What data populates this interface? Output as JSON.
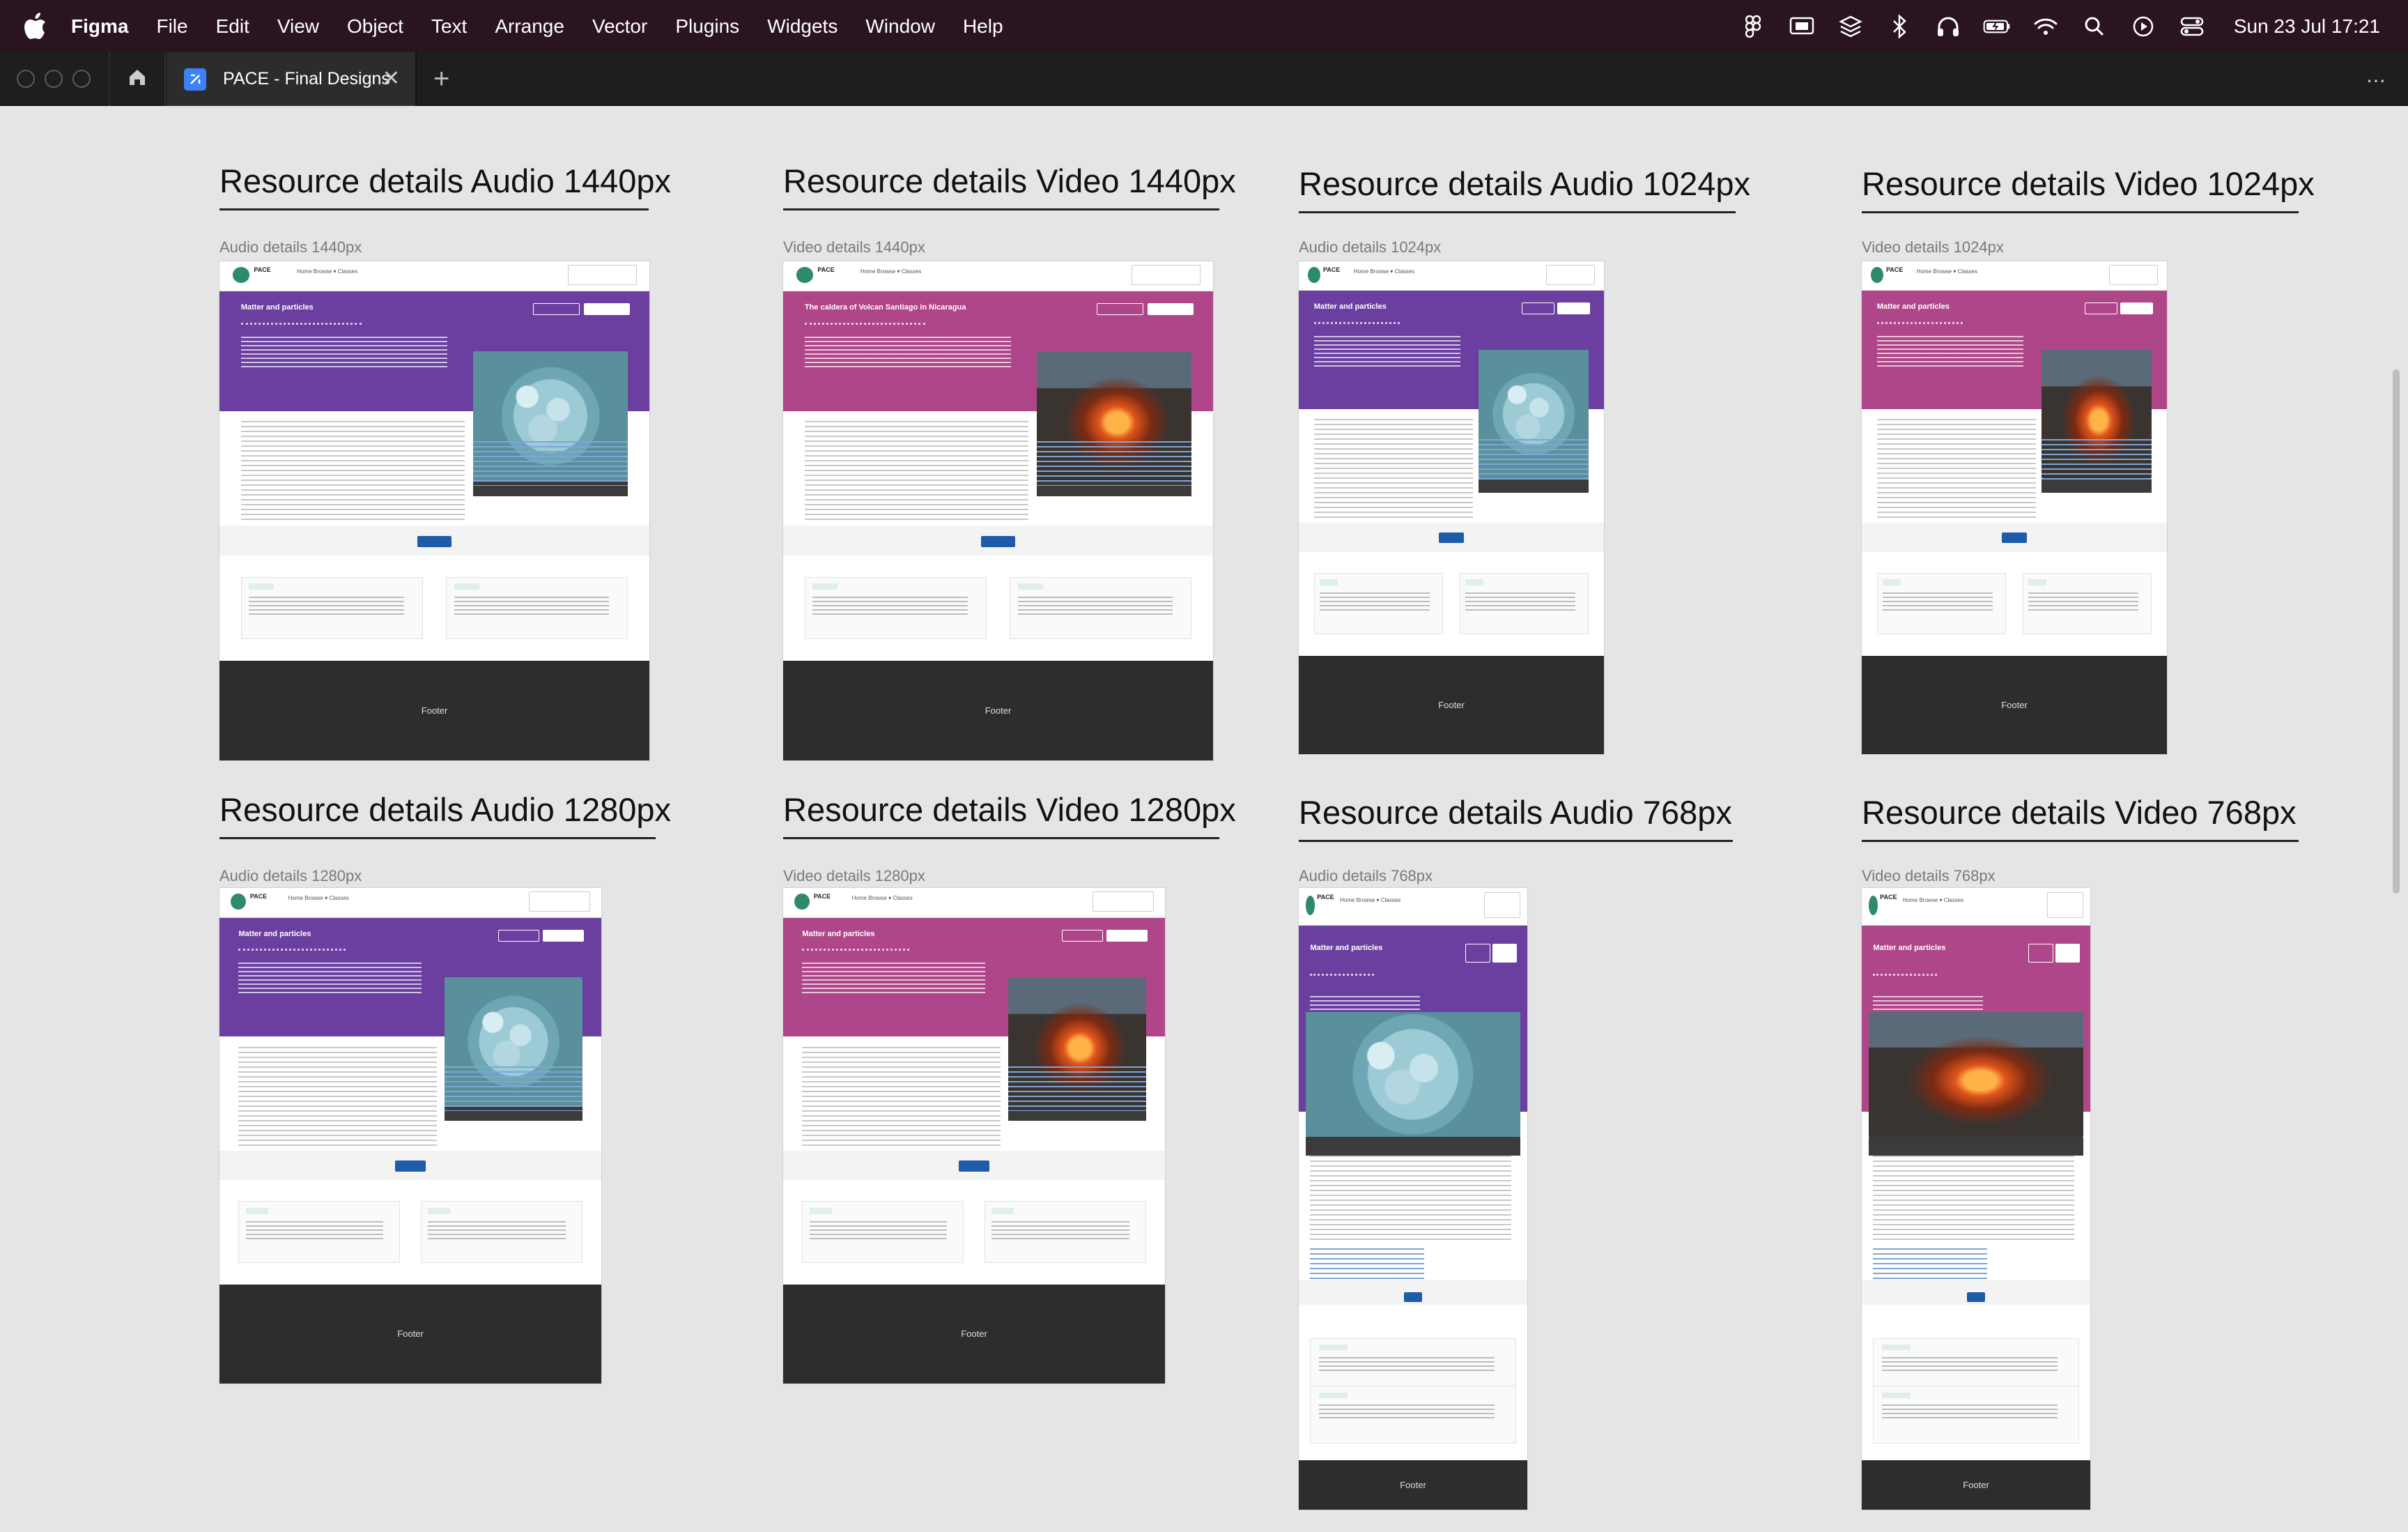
{
  "menubar": {
    "app_name": "Figma",
    "items": [
      "File",
      "Edit",
      "View",
      "Object",
      "Text",
      "Arrange",
      "Vector",
      "Plugins",
      "Widgets",
      "Window",
      "Help"
    ],
    "clock": "Sun 23 Jul  17:21",
    "status_icons": [
      "figma-icon",
      "screen-mirror-icon",
      "layers-icon",
      "bluetooth-icon",
      "headphones-icon",
      "battery-icon",
      "wifi-icon",
      "search-icon",
      "play-icon",
      "control-center-icon"
    ]
  },
  "tabbar": {
    "active_tab": "PACE - Final Designs",
    "new_tab": "+",
    "more": "⋯",
    "close": "✕"
  },
  "colors": {
    "audio_hero": "#6b3fa0",
    "video_hero": "#b0468a",
    "footer": "#2d2d2d",
    "menubar": "#2a1420",
    "link": "#1e5ba8"
  },
  "frame_content": {
    "nav_links": "Home  Browse ▾  Classes",
    "logo": "PACE",
    "audio_title": "Matter and particles",
    "video_title": "The caldera of Volcan Santiago in Nicaragua",
    "video_title_short": "Matter and particles",
    "footer": "Footer"
  },
  "sections": [
    {
      "title": "Resource details Audio 1440px",
      "label": "Audio details 1440px"
    },
    {
      "title": "Resource details Video 1440px",
      "label": "Video details 1440px"
    },
    {
      "title": "Resource details Audio 1024px",
      "label": "Audio details 1024px"
    },
    {
      "title": "Resource details Video 1024px",
      "label": "Video details 1024px"
    },
    {
      "title": "Resource details Audio 1280px",
      "label": "Audio details 1280px"
    },
    {
      "title": "Resource details Video 1280px",
      "label": "Video details 1280px"
    },
    {
      "title": "Resource details Audio 768px",
      "label": "Audio details 768px"
    },
    {
      "title": "Resource details Video 768px",
      "label": "Video details 768px"
    }
  ]
}
